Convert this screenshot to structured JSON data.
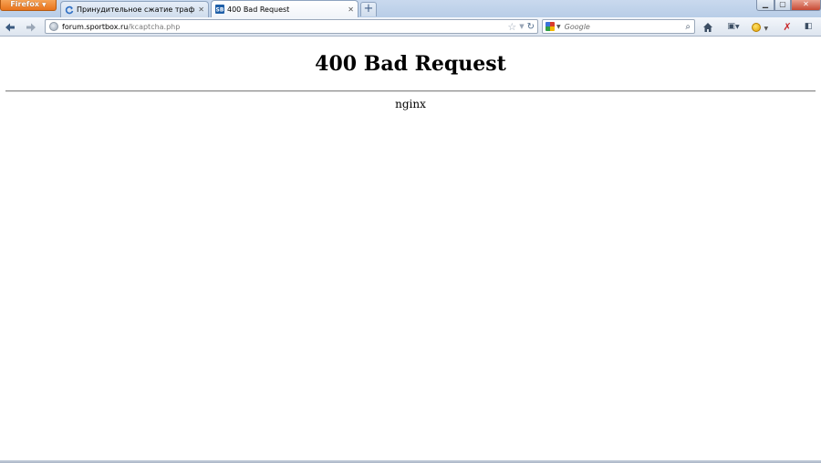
{
  "browser": {
    "menu_label": "Firefox",
    "tabs": [
      {
        "title": "Принудительное сжатие трафика - ...",
        "icon": "refresh-icon"
      },
      {
        "title": "400 Bad Request",
        "icon": "sb-site-icon"
      }
    ],
    "new_tab_label": "+",
    "window_controls": {
      "minimize": "▁",
      "maximize": "▢",
      "close": "✕"
    }
  },
  "navigation": {
    "url_domain": "forum.sportbox.ru",
    "url_path": "/kcaptcha.php",
    "search_placeholder": "Google",
    "search_engine": "Google"
  },
  "page": {
    "heading": "400 Bad Request",
    "server": "nginx"
  },
  "colors": {
    "firefox_button": "#e8741c",
    "tabstrip": "#c9d9ee",
    "toolbar": "#dde5ef",
    "close_button": "#c74a34"
  }
}
